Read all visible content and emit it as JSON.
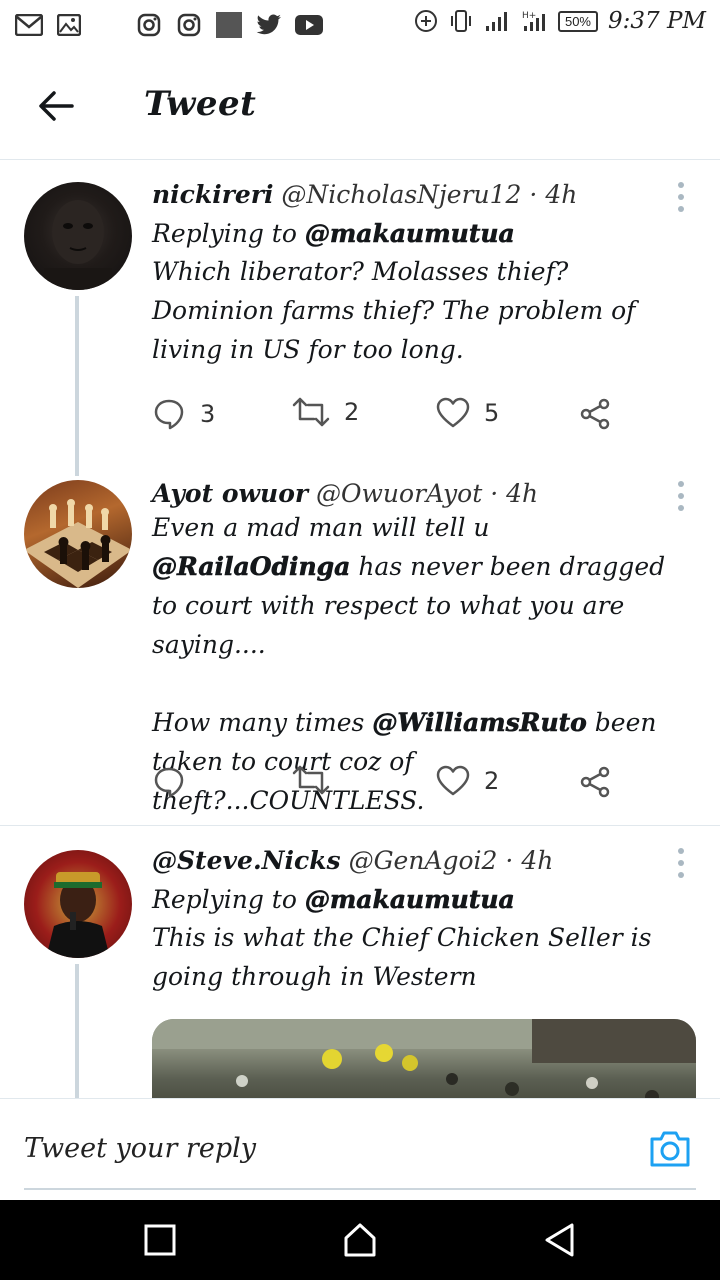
{
  "status_bar": {
    "battery": "50%",
    "time": "9:37 PM"
  },
  "header": {
    "title": "Tweet"
  },
  "tweets": [
    {
      "name": "nickireri",
      "handle": "@NicholasNjeru12",
      "dot": "·",
      "time": "4h",
      "replying_prefix": "Replying to",
      "replying_to": "@makaumutua",
      "text": "Which liberator? Molasses thief? Dominion farms thief? The problem of living in US for too long.",
      "replies": "3",
      "retweets": "2",
      "likes": "5"
    },
    {
      "name": "Ayot owuor",
      "handle": "@OwuorAyot",
      "dot": "·",
      "time": "4h",
      "text_part1": "Even a mad man will tell u",
      "mention1": "@RailaOdinga",
      "text_part2": "has never been dragged to court with respect to what you are saying....",
      "text_part3": "How many times",
      "mention2": "@WilliamsRuto",
      "text_part4": " been taken to court coz of theft?...COUNTLESS.",
      "replies": "",
      "retweets": "",
      "likes": "2"
    },
    {
      "name": "@Steve.Nicks",
      "handle": "@GenAgoi2",
      "dot": "·",
      "time": "4h",
      "replying_prefix": "Replying to",
      "replying_to": "@makaumutua",
      "text": "This is what the Chief Chicken Seller is going through in Western"
    }
  ],
  "reply_bar": {
    "placeholder": "Tweet your reply"
  },
  "colors": {
    "accent": "#1da1f2",
    "divider": "#e1e8ed",
    "thread_line": "#ccd6dd"
  }
}
